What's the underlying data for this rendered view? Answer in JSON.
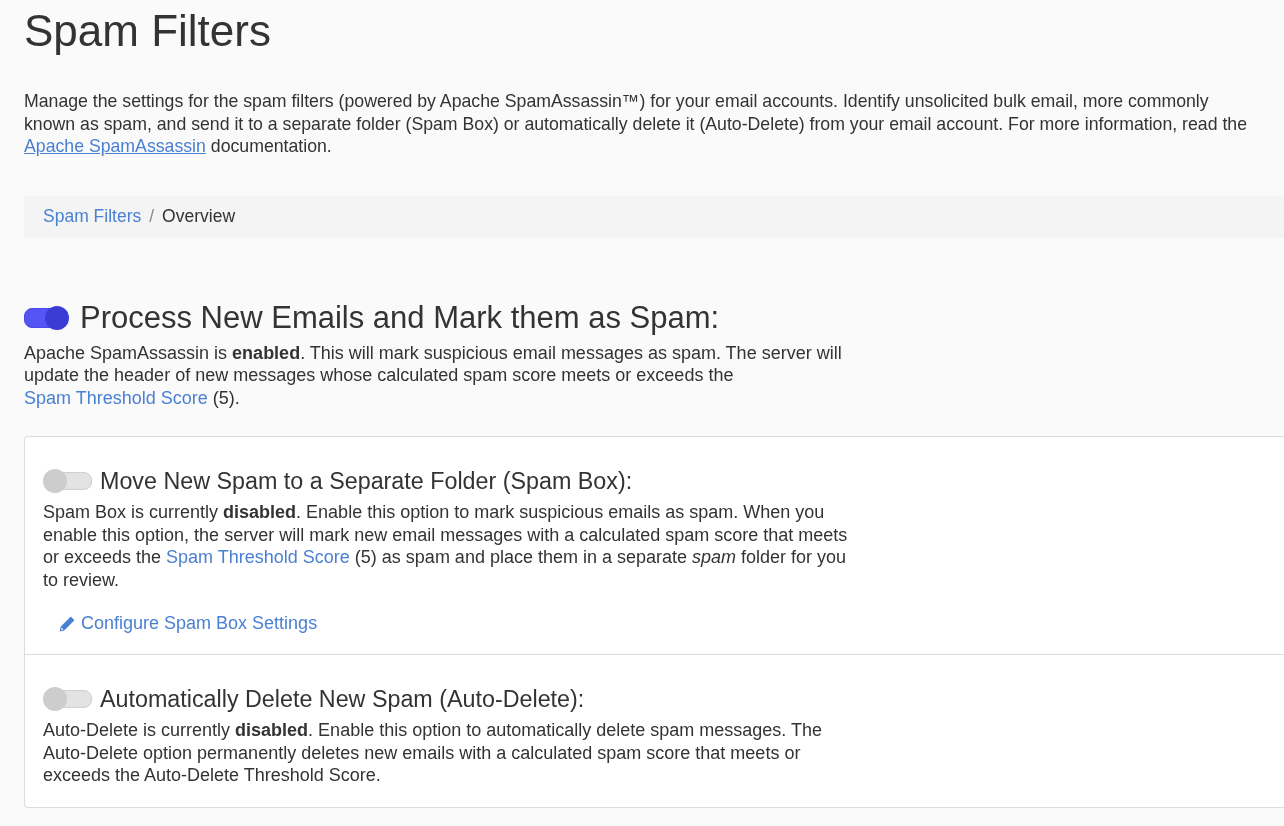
{
  "page": {
    "title": "Spam Filters",
    "description": [
      {
        "kind": "text",
        "text": "Manage the settings for the spam filters (powered by Apache SpamAssassin™) for your email accounts. Identify unsolicited bulk email, more commonly known as spam, and send it to a separate folder (Spam Box) or automatically delete it (Auto-Delete) from your email account. For more information, read the "
      },
      {
        "kind": "link",
        "text": "Apache SpamAssassin"
      },
      {
        "kind": "text",
        "text": " documentation."
      }
    ]
  },
  "breadcrumb": {
    "separator": "/",
    "items": [
      {
        "label": "Spam Filters",
        "selected": false
      },
      {
        "label": "Overview",
        "selected": true
      }
    ]
  },
  "main_setting": {
    "title": "Process New Emails and Mark them as Spam:",
    "on": true,
    "description": [
      {
        "kind": "text",
        "text": "Apache SpamAssassin is **enabled**. This will mark suspicious email messages as spam. The server will update the header of new messages whose calculated spam score meets or exceeds the "
      },
      {
        "kind": "link",
        "text": "Spam Threshold Score"
      },
      {
        "kind": "text",
        "text": " (5)."
      }
    ]
  },
  "settings": [
    {
      "title": "Move New Spam to a Separate Folder (Spam Box):",
      "on": false,
      "description": [
        {
          "kind": "text",
          "text": "Spam Box is currently **disabled**. Enable this option to mark suspicious emails as spam. When you enable this option, the server will mark new email messages with a calculated spam score that meets or exceeds the "
        },
        {
          "kind": "link",
          "text": "Spam Threshold Score"
        },
        {
          "kind": "text",
          "text": " (5) as spam and place them in a separate *spam* folder for you to review."
        }
      ],
      "action": "Configure Spam Box Settings"
    },
    {
      "title": "Automatically Delete New Spam (Auto-Delete):",
      "on": false,
      "description": [
        {
          "kind": "text",
          "text": "Auto-Delete is currently **disabled**. Enable this option to automatically delete spam messages. The Auto-Delete option permanently deletes new emails with a calculated spam score that meets or exceeds the Auto-Delete Threshold Score."
        }
      ]
    }
  ]
}
